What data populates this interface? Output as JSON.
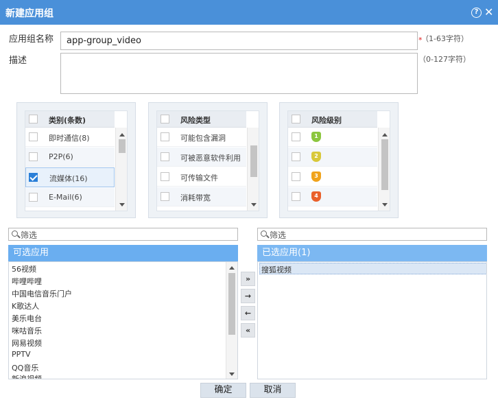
{
  "dialog": {
    "title": "新建应用组",
    "help_icon": "question-circle-icon",
    "close_icon": "close-icon"
  },
  "form": {
    "name_label": "应用组名称",
    "name_value": "app-group_video",
    "required_mark": "*",
    "name_hint": "（1-63字符）",
    "desc_label": "描述",
    "desc_hint": "（0-127字符）"
  },
  "category_panel": {
    "header": "类别(条数)",
    "rows": [
      {
        "label": "即时通信(8)",
        "checked": false
      },
      {
        "label": "P2P(6)",
        "checked": false
      },
      {
        "label": "流媒体(16)",
        "checked": true
      },
      {
        "label": "E-Mail(6)",
        "checked": false
      }
    ]
  },
  "risk_type_panel": {
    "header": "风险类型",
    "rows": [
      {
        "label": "可能包含漏洞"
      },
      {
        "label": "可被恶意软件利用"
      },
      {
        "label": "可传输文件"
      },
      {
        "label": "消耗带宽"
      }
    ]
  },
  "risk_level_panel": {
    "header": "风险级别",
    "levels": [
      {
        "value": "1",
        "color": "#8cc63f"
      },
      {
        "value": "2",
        "color": "#d8c83a"
      },
      {
        "value": "3",
        "color": "#f0a31c"
      },
      {
        "value": "4",
        "color": "#e9602a"
      }
    ]
  },
  "available": {
    "filter_placeholder": "筛选",
    "header": "可选应用",
    "items": [
      "56视频",
      "哔哩哔哩",
      "中国电信音乐门户",
      "K歌达人",
      "美乐电台",
      "咪咕音乐",
      "网易视频",
      "PPTV",
      "QQ音乐",
      "新浪视频"
    ]
  },
  "transfer": {
    "add_all": "»",
    "add": "→",
    "remove": "←",
    "remove_all": "«"
  },
  "selected": {
    "filter_placeholder": "筛选",
    "header": "已选应用(1)",
    "items": [
      "搜狐视频"
    ]
  },
  "buttons": {
    "ok": "确定",
    "cancel": "取消"
  },
  "colors": {
    "titlebar": "#4a90d9",
    "list_header": "#6aaef0",
    "checkbox_on": "#2a7fd8"
  }
}
